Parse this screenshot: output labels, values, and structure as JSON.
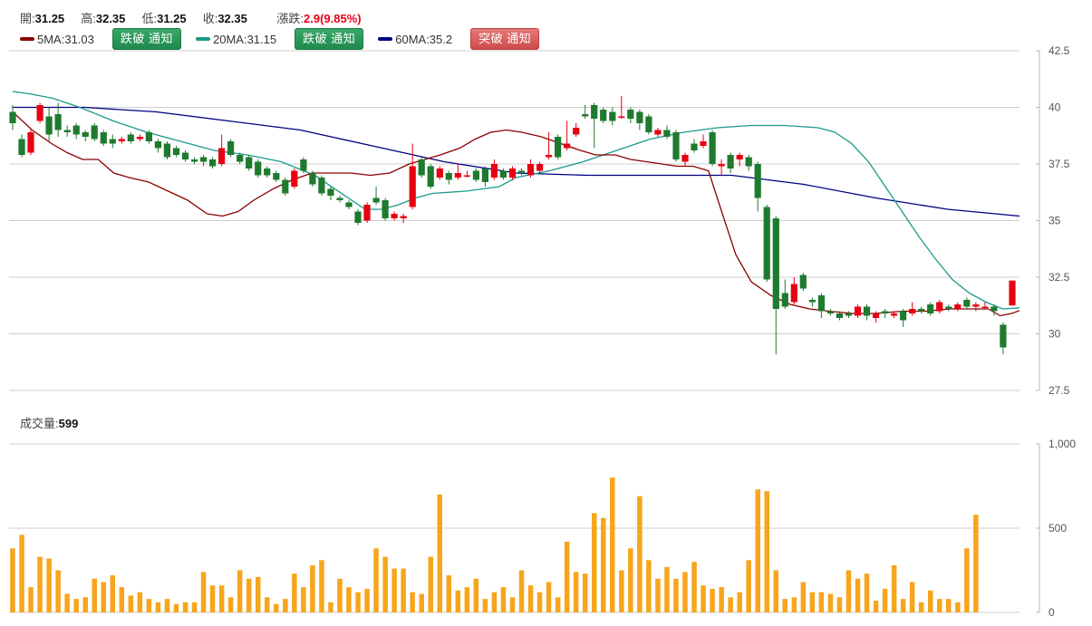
{
  "quote": {
    "open_label": "開:",
    "open": "31.25",
    "high_label": "高:",
    "high": "32.35",
    "low_label": "低:",
    "low": "31.25",
    "close_label": "收:",
    "close": "32.35",
    "change_label": "漲跌:",
    "change": "2.9(9.85%)"
  },
  "ma_legend": [
    {
      "label": "5MA:31.03",
      "color": "#8b0000",
      "button": "跌破 通知",
      "button_kind": "down"
    },
    {
      "label": "20MA:31.15",
      "color": "#1a9a8a",
      "button": "跌破 通知",
      "button_kind": "down"
    },
    {
      "label": "60MA:35.2",
      "color": "#000080",
      "button": "突破 通知",
      "button_kind": "up"
    }
  ],
  "volume_info": {
    "label": "成交量:",
    "value": "599"
  },
  "colors": {
    "up": "#e60012",
    "down": "#1e7a2e",
    "volume": "#f7a51c",
    "ma5": "#8b0000",
    "ma20": "#1a9a8a",
    "ma60": "#000080",
    "grid": "#cccccc"
  },
  "chart_data": [
    {
      "type": "candlestick",
      "y_ticks": [
        "42.5",
        "40",
        "37.5",
        "35",
        "32.5",
        "30",
        "27.5"
      ],
      "ylim": [
        27.5,
        42.5
      ],
      "grid": true,
      "candles": [
        [
          39.8,
          39.3,
          40.1,
          39.0
        ],
        [
          38.6,
          37.9,
          38.8,
          37.8
        ],
        [
          38.0,
          38.9,
          39.0,
          37.9
        ],
        [
          39.4,
          40.1,
          40.2,
          39.3
        ],
        [
          39.6,
          38.8,
          40.0,
          38.5
        ],
        [
          39.7,
          39.0,
          40.2,
          38.7
        ],
        [
          39.0,
          38.9,
          39.2,
          38.7
        ],
        [
          39.2,
          38.8,
          39.3,
          38.6
        ],
        [
          38.9,
          38.7,
          39.0,
          38.5
        ],
        [
          39.2,
          38.6,
          39.3,
          38.5
        ],
        [
          38.9,
          38.4,
          39.0,
          38.3
        ],
        [
          38.6,
          38.4,
          38.8,
          38.2
        ],
        [
          38.5,
          38.6,
          38.7,
          38.4
        ],
        [
          38.8,
          38.5,
          38.9,
          38.4
        ],
        [
          38.6,
          38.7,
          38.8,
          38.5
        ],
        [
          38.9,
          38.5,
          39.0,
          38.4
        ],
        [
          38.5,
          38.2,
          38.6,
          38.0
        ],
        [
          38.4,
          37.8,
          38.5,
          37.7
        ],
        [
          38.2,
          37.9,
          38.3,
          37.8
        ],
        [
          38.0,
          37.7,
          38.1,
          37.6
        ],
        [
          37.7,
          37.6,
          37.8,
          37.5
        ],
        [
          37.8,
          37.6,
          37.9,
          37.4
        ],
        [
          37.7,
          37.4,
          37.8,
          37.3
        ],
        [
          37.5,
          38.2,
          38.8,
          37.4
        ],
        [
          38.5,
          37.9,
          38.6,
          37.8
        ],
        [
          37.9,
          37.6,
          38.0,
          37.5
        ],
        [
          37.8,
          37.3,
          37.9,
          37.2
        ],
        [
          37.6,
          37.0,
          37.7,
          36.9
        ],
        [
          37.3,
          37.0,
          37.4,
          36.9
        ],
        [
          37.1,
          36.8,
          37.2,
          36.7
        ],
        [
          36.8,
          36.2,
          36.9,
          36.1
        ],
        [
          36.5,
          37.2,
          37.3,
          36.4
        ],
        [
          37.7,
          37.2,
          37.8,
          37.1
        ],
        [
          37.1,
          36.6,
          37.2,
          36.5
        ],
        [
          36.9,
          36.2,
          37.0,
          36.1
        ],
        [
          36.4,
          36.1,
          36.5,
          35.9
        ],
        [
          36.0,
          35.9,
          36.1,
          35.8
        ],
        [
          35.8,
          35.6,
          35.9,
          35.5
        ],
        [
          35.4,
          34.9,
          35.5,
          34.8
        ],
        [
          35.0,
          35.7,
          35.8,
          34.9
        ],
        [
          36.0,
          35.8,
          36.5,
          35.7
        ],
        [
          35.9,
          35.1,
          36.0,
          35.0
        ],
        [
          35.1,
          35.3,
          35.4,
          35.0
        ],
        [
          35.1,
          35.2,
          35.3,
          34.9
        ],
        [
          35.6,
          37.4,
          38.4,
          35.5
        ],
        [
          37.7,
          37.0,
          37.8,
          36.9
        ],
        [
          37.4,
          36.5,
          37.5,
          36.4
        ],
        [
          36.9,
          37.3,
          37.4,
          36.8
        ],
        [
          37.1,
          36.8,
          37.2,
          36.6
        ],
        [
          36.9,
          37.1,
          37.5,
          36.8
        ],
        [
          37.0,
          37.0,
          37.2,
          36.9
        ],
        [
          37.2,
          36.8,
          37.3,
          36.7
        ],
        [
          37.3,
          36.7,
          37.4,
          36.5
        ],
        [
          36.9,
          37.5,
          37.7,
          36.8
        ],
        [
          37.2,
          36.9,
          37.3,
          36.8
        ],
        [
          36.9,
          37.3,
          37.4,
          36.8
        ],
        [
          37.2,
          37.1,
          37.3,
          37.0
        ],
        [
          37.0,
          37.5,
          37.7,
          36.9
        ],
        [
          37.2,
          37.5,
          37.6,
          37.1
        ],
        [
          37.8,
          37.9,
          38.9,
          37.7
        ],
        [
          38.7,
          37.8,
          38.8,
          37.7
        ],
        [
          38.2,
          38.4,
          39.4,
          38.1
        ],
        [
          38.8,
          39.1,
          39.3,
          38.7
        ],
        [
          39.7,
          39.6,
          40.1,
          39.5
        ],
        [
          40.1,
          39.5,
          40.2,
          38.2
        ],
        [
          39.9,
          39.4,
          40.0,
          39.3
        ],
        [
          39.8,
          39.4,
          40.0,
          39.2
        ],
        [
          39.6,
          39.6,
          40.5,
          39.5
        ],
        [
          39.9,
          39.5,
          40.0,
          39.3
        ],
        [
          39.8,
          39.3,
          39.9,
          39.0
        ],
        [
          39.6,
          38.9,
          39.7,
          38.8
        ],
        [
          38.8,
          39.0,
          39.1,
          38.7
        ],
        [
          39.0,
          38.7,
          39.2,
          38.6
        ],
        [
          38.9,
          37.7,
          39.0,
          37.6
        ],
        [
          37.6,
          37.9,
          38.0,
          37.4
        ],
        [
          38.4,
          38.1,
          38.6,
          38.0
        ],
        [
          38.3,
          38.5,
          38.8,
          38.2
        ],
        [
          38.9,
          37.5,
          39.0,
          37.4
        ],
        [
          37.4,
          37.5,
          37.7,
          37.0
        ],
        [
          37.9,
          37.3,
          38.0,
          37.1
        ],
        [
          37.7,
          37.9,
          38.0,
          37.4
        ],
        [
          37.8,
          37.4,
          37.9,
          37.2
        ],
        [
          37.5,
          36.0,
          37.6,
          35.4
        ],
        [
          35.6,
          32.4,
          35.7,
          32.3
        ],
        [
          35.1,
          31.1,
          35.2,
          29.1
        ],
        [
          31.8,
          31.2,
          32.4,
          31.1
        ],
        [
          31.4,
          32.2,
          32.5,
          31.3
        ],
        [
          32.6,
          32.0,
          32.7,
          31.9
        ],
        [
          31.5,
          31.4,
          31.6,
          31.2
        ],
        [
          31.7,
          31.0,
          31.8,
          30.7
        ],
        [
          31.0,
          30.9,
          31.1,
          30.8
        ],
        [
          30.9,
          30.7,
          31.0,
          30.6
        ],
        [
          30.9,
          30.8,
          31.0,
          30.7
        ],
        [
          30.8,
          31.2,
          31.3,
          30.7
        ],
        [
          31.2,
          30.8,
          31.3,
          30.6
        ],
        [
          30.7,
          30.9,
          31.0,
          30.5
        ],
        [
          31.0,
          30.9,
          31.1,
          30.7
        ],
        [
          30.8,
          30.9,
          31.0,
          30.7
        ],
        [
          31.0,
          30.6,
          31.1,
          30.3
        ],
        [
          30.9,
          31.1,
          31.4,
          30.8
        ],
        [
          31.1,
          31.0,
          31.2,
          30.9
        ],
        [
          31.3,
          30.9,
          31.4,
          30.8
        ],
        [
          31.0,
          31.4,
          31.5,
          30.9
        ],
        [
          31.2,
          31.1,
          31.3,
          31.0
        ],
        [
          31.1,
          31.3,
          31.4,
          31.0
        ],
        [
          31.5,
          31.2,
          31.6,
          31.1
        ],
        [
          31.2,
          31.3,
          31.4,
          31.0
        ],
        [
          31.2,
          31.2,
          31.4,
          31.1
        ],
        [
          31.2,
          31.0,
          31.3,
          30.8
        ],
        [
          30.4,
          29.4,
          30.5,
          29.1
        ],
        [
          31.25,
          32.35,
          32.35,
          31.25
        ]
      ],
      "ma5": [
        [
          0,
          39.8
        ],
        [
          10,
          39.0
        ],
        [
          20,
          38.4
        ],
        [
          28,
          38.0
        ],
        [
          36,
          37.7
        ],
        [
          44,
          37.7
        ],
        [
          52,
          37.1
        ],
        [
          60,
          36.9
        ],
        [
          70,
          36.7
        ],
        [
          80,
          36.3
        ],
        [
          90,
          35.9
        ],
        [
          100,
          35.3
        ],
        [
          108,
          35.2
        ],
        [
          116,
          35.4
        ],
        [
          124,
          35.9
        ],
        [
          134,
          36.4
        ],
        [
          144,
          36.8
        ],
        [
          154,
          37.1
        ],
        [
          164,
          37.1
        ],
        [
          174,
          37.1
        ],
        [
          184,
          37.0
        ],
        [
          194,
          37.1
        ],
        [
          204,
          37.5
        ],
        [
          212,
          37.7
        ],
        [
          220,
          37.9
        ],
        [
          230,
          38.2
        ],
        [
          238,
          38.6
        ],
        [
          246,
          38.9
        ],
        [
          254,
          39.0
        ],
        [
          262,
          38.9
        ],
        [
          272,
          38.7
        ],
        [
          282,
          38.4
        ],
        [
          292,
          38.1
        ],
        [
          300,
          37.9
        ],
        [
          310,
          37.9
        ],
        [
          318,
          37.7
        ],
        [
          326,
          37.6
        ],
        [
          334,
          37.5
        ],
        [
          342,
          37.4
        ],
        [
          350,
          37.4
        ],
        [
          358,
          37.2
        ],
        [
          364,
          35.6
        ],
        [
          372,
          33.5
        ],
        [
          380,
          32.3
        ],
        [
          390,
          31.7
        ],
        [
          400,
          31.3
        ],
        [
          410,
          31.1
        ],
        [
          420,
          31.0
        ],
        [
          432,
          30.9
        ],
        [
          444,
          30.9
        ],
        [
          458,
          31.0
        ],
        [
          470,
          31.0
        ],
        [
          482,
          31.1
        ],
        [
          494,
          31.1
        ],
        [
          502,
          31.1
        ],
        [
          508,
          30.8
        ],
        [
          514,
          30.9
        ],
        [
          518,
          31.03
        ]
      ],
      "ma20": [
        [
          0,
          40.7
        ],
        [
          10,
          40.6
        ],
        [
          24,
          40.4
        ],
        [
          40,
          40.0
        ],
        [
          60,
          39.4
        ],
        [
          80,
          38.9
        ],
        [
          100,
          38.5
        ],
        [
          120,
          38.1
        ],
        [
          140,
          37.9
        ],
        [
          160,
          37.6
        ],
        [
          180,
          37.0
        ],
        [
          200,
          36.0
        ],
        [
          210,
          35.5
        ],
        [
          220,
          35.5
        ],
        [
          230,
          35.7
        ],
        [
          240,
          36.0
        ],
        [
          250,
          36.2
        ],
        [
          270,
          36.3
        ],
        [
          290,
          36.5
        ],
        [
          300,
          36.9
        ],
        [
          320,
          37.2
        ],
        [
          340,
          37.6
        ],
        [
          360,
          38.1
        ],
        [
          380,
          38.6
        ],
        [
          400,
          38.9
        ],
        [
          420,
          39.1
        ],
        [
          440,
          39.2
        ],
        [
          460,
          39.2
        ],
        [
          480,
          39.1
        ],
        [
          490,
          38.9
        ],
        [
          500,
          38.4
        ],
        [
          510,
          37.6
        ],
        [
          520,
          36.5
        ],
        [
          530,
          35.4
        ],
        [
          540,
          34.3
        ],
        [
          550,
          33.3
        ],
        [
          560,
          32.4
        ],
        [
          570,
          31.8
        ],
        [
          580,
          31.4
        ],
        [
          590,
          31.1
        ],
        [
          600,
          31.15
        ]
      ],
      "ma60": [
        [
          0,
          40.0
        ],
        [
          100,
          40.0
        ],
        [
          200,
          39.8
        ],
        [
          300,
          39.4
        ],
        [
          400,
          39.0
        ],
        [
          500,
          38.3
        ],
        [
          600,
          37.6
        ],
        [
          700,
          37.1
        ],
        [
          800,
          37.0
        ],
        [
          900,
          37.0
        ],
        [
          1000,
          37.0
        ],
        [
          1100,
          36.6
        ],
        [
          1200,
          36.0
        ],
        [
          1300,
          35.5
        ],
        [
          1400,
          35.2
        ]
      ],
      "volume": [
        380,
        460,
        150,
        330,
        320,
        250,
        110,
        80,
        90,
        200,
        180,
        220,
        150,
        100,
        120,
        80,
        60,
        80,
        50,
        60,
        60,
        240,
        160,
        160,
        90,
        250,
        200,
        210,
        90,
        50,
        80,
        230,
        150,
        280,
        310,
        60,
        200,
        150,
        120,
        140,
        380,
        330,
        260,
        260,
        120,
        110,
        330,
        700,
        220,
        130,
        150,
        200,
        80,
        120,
        150,
        90,
        250,
        160,
        120,
        180,
        90,
        420,
        240,
        230,
        590,
        560,
        800,
        250,
        380,
        690,
        310,
        200,
        270,
        200,
        240,
        300,
        160,
        140,
        150,
        90,
        120,
        310,
        730,
        720,
        250,
        80,
        90,
        180,
        120,
        120,
        110,
        90,
        250,
        200,
        230,
        70,
        140,
        280,
        80,
        180,
        60,
        130,
        80,
        80,
        60,
        380,
        580
      ]
    },
    {
      "type": "bar",
      "title": "成交量",
      "y_ticks": [
        "1,000",
        "500",
        "0"
      ],
      "ylim": [
        0,
        1000
      ],
      "grid": true
    }
  ]
}
